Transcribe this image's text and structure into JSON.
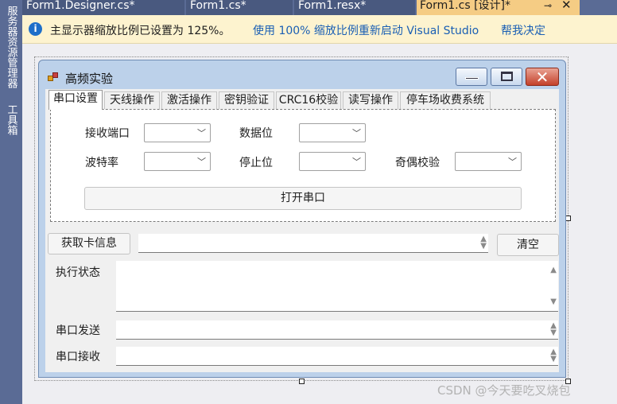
{
  "ide": {
    "left_tabs": {
      "server_explorer": "服务器资源管理器",
      "toolbox": "工具箱"
    },
    "doc_tabs": [
      "Form1.Designer.cs*",
      "Form1.cs*",
      "Form1.resx*",
      "Form1.cs [设计]*"
    ],
    "pin_icon": "⊸",
    "close_icon": "✕",
    "infobar": {
      "icon": "i",
      "message": "主显示器缩放比例已设置为 125%。",
      "restart_link": "使用 100% 缩放比例重新启动 Visual Studio",
      "help_link": "帮我决定"
    }
  },
  "form": {
    "title": "高频实验",
    "tabs": [
      "串口设置",
      "天线操作",
      "激活操作",
      "密钥验证",
      "CRC16校验",
      "读写操作",
      "停车场收费系统"
    ],
    "selected_tab": 0,
    "serial": {
      "receive_port_label": "接收端口",
      "data_bits_label": "数据位",
      "baud_rate_label": "波特率",
      "stop_bits_label": "停止位",
      "parity_label": "奇偶校验",
      "open_port_button": "打开串口"
    },
    "get_card_button": "获取卡信息",
    "clear_button": "清空",
    "status_label": "执行状态",
    "send_label": "串口发送",
    "receive_label": "串口接收"
  },
  "watermark": "CSDN @今天要吃叉烧包"
}
